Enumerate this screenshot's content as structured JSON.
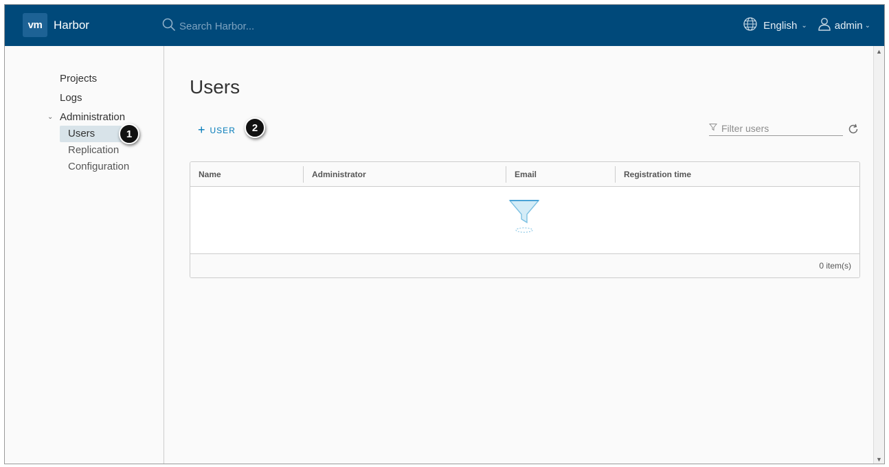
{
  "header": {
    "logo_text": "vm",
    "app_name": "Harbor",
    "search_placeholder": "Search Harbor...",
    "language": "English",
    "user": "admin",
    "bg_color": "#00497a"
  },
  "sidebar": {
    "items": [
      {
        "label": "Projects"
      },
      {
        "label": "Logs"
      },
      {
        "label": "Administration"
      }
    ],
    "admin_children": [
      {
        "label": "Users",
        "active": true
      },
      {
        "label": "Replication"
      },
      {
        "label": "Configuration"
      }
    ]
  },
  "main": {
    "title": "Users",
    "add_button": "USER",
    "filter_placeholder": "Filter users",
    "columns": [
      "Name",
      "Administrator",
      "Email",
      "Registration time"
    ],
    "rows": [],
    "footer_count": "0 item(s)"
  },
  "callouts": [
    "1",
    "2"
  ],
  "icons": [
    "search-icon",
    "globe-icon",
    "user-icon",
    "chevron-down-icon",
    "plus-icon",
    "filter-icon",
    "refresh-icon",
    "empty-funnel-icon"
  ]
}
